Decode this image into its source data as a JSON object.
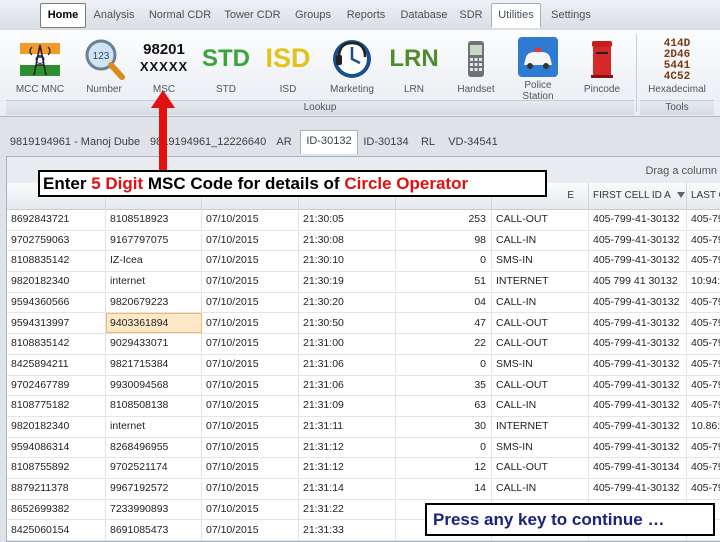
{
  "menu": [
    "Home",
    "Analysis",
    "Normal CDR",
    "Tower CDR",
    "Groups",
    "Reports",
    "Database",
    "SDR",
    "Utilities",
    "Settings"
  ],
  "ribbon": {
    "buttons": [
      {
        "label": "MCC MNC",
        "icon": "india-flag-tower-icon"
      },
      {
        "label": "Number",
        "icon": "magnifier-123-icon"
      },
      {
        "label": "MSC",
        "icon": "msc-text-icon",
        "text1": "98201",
        "text2": "XXXXX"
      },
      {
        "label": "STD",
        "icon": "std-text-icon",
        "text": "STD"
      },
      {
        "label": "ISD",
        "icon": "isd-text-icon",
        "text": "ISD"
      },
      {
        "label": "Marketing",
        "icon": "headset-clock-icon"
      },
      {
        "label": "LRN",
        "icon": "lrn-text-icon",
        "text": "LRN"
      },
      {
        "label": "Handset",
        "icon": "mobile-phone-icon"
      },
      {
        "label": "Police Station",
        "icon": "police-car-icon"
      },
      {
        "label": "Pincode",
        "icon": "postbox-icon"
      },
      {
        "label": "Hexadecimal",
        "icon": "hex-digits-icon",
        "text": "414D\n2D46\n5441\n4C52"
      }
    ],
    "groups": {
      "lookup": "Lookup",
      "tools": "Tools"
    }
  },
  "tabs": [
    "9819194961 - Manoj Dube",
    "9819194961_12226640",
    "AR",
    "ID-30132",
    "ID-30134",
    "RL",
    "VD-34541"
  ],
  "grid": {
    "group_hint": "Drag a column",
    "headers": [
      "",
      "",
      "",
      "",
      "",
      "FIRST CELL ID A",
      "LAST C"
    ],
    "header_tail": "E",
    "rows": [
      [
        "8692843721",
        "8108518923",
        "07/10/2015",
        "21:30:05",
        "253",
        "CALL-OUT",
        "405-799-41-30132",
        "405-799"
      ],
      [
        "9702759063",
        "9167797075",
        "07/10/2015",
        "21:30:08",
        "98",
        "CALL-IN",
        "405-799-41-30132",
        "405-799"
      ],
      [
        "8108835142",
        "IZ-Icea",
        "07/10/2015",
        "21:30:10",
        "0",
        "SMS-IN",
        "405-799-41-30132",
        "405-799"
      ],
      [
        "9820182340",
        "internet",
        "07/10/2015",
        "21:30:19",
        "51",
        "INTERNET",
        "405 799 41 30132",
        "10:94:2"
      ],
      [
        "9594360566",
        "9820679223",
        "07/10/2015",
        "21:30:20",
        "04",
        "CALL-IN",
        "405-799-41-30132",
        "405-799"
      ],
      [
        "9594313997",
        "9403361894",
        "07/10/2015",
        "21:30:50",
        "47",
        "CALL-OUT",
        "405-799-41-30132",
        "405-799"
      ],
      [
        "8108835142",
        "9029433071",
        "07/10/2015",
        "21:31:00",
        "22",
        "CALL-OUT",
        "405-799-41-30132",
        "405-799"
      ],
      [
        "8425894211",
        "9821715384",
        "07/10/2015",
        "21:31:06",
        "0",
        "SMS-IN",
        "405-799-41-30132",
        "405-799"
      ],
      [
        "9702467789",
        "9930094568",
        "07/10/2015",
        "21:31:06",
        "35",
        "CALL-OUT",
        "405-799-41-30132",
        "405-799"
      ],
      [
        "8108775182",
        "8108508138",
        "07/10/2015",
        "21:31:09",
        "63",
        "CALL-IN",
        "405-799-41-30132",
        "405-799"
      ],
      [
        "9820182340",
        "internet",
        "07/10/2015",
        "21:31:11",
        "30",
        "INTERNET",
        "405-799-41-30132",
        "10.86:1"
      ],
      [
        "9594086314",
        "8268496955",
        "07/10/2015",
        "21:31:12",
        "0",
        "SMS-IN",
        "405-799-41-30132",
        "405-799"
      ],
      [
        "8108755892",
        "9702521174",
        "07/10/2015",
        "21:31:12",
        "12",
        "CALL-OUT",
        "405-799-41-30134",
        "405-799"
      ],
      [
        "8879211378",
        "9967192572",
        "07/10/2015",
        "21:31:14",
        "14",
        "CALL-IN",
        "405-799-41-30132",
        "405-799"
      ],
      [
        "8652699382",
        "7233990893",
        "07/10/2015",
        "21:31:22",
        "",
        "",
        " ",
        ""
      ],
      [
        "8425060154",
        "8691085473",
        "07/10/2015",
        "21:31:33",
        "",
        "",
        "",
        ""
      ]
    ],
    "highlight": {
      "row": 5,
      "col": 1
    }
  },
  "callout": {
    "p1": "Enter ",
    "p2": "5 Digit",
    "p3": " MSC Code for details of ",
    "p4": "Circle Operator"
  },
  "continue_text": "Press any key to continue …",
  "colors": {
    "accent_red": "#e41010",
    "std_green": "#3aa53a",
    "isd_yellow": "#e3c21a",
    "lrn_green": "#4f8d2f",
    "continue_text": "#1a237e"
  }
}
